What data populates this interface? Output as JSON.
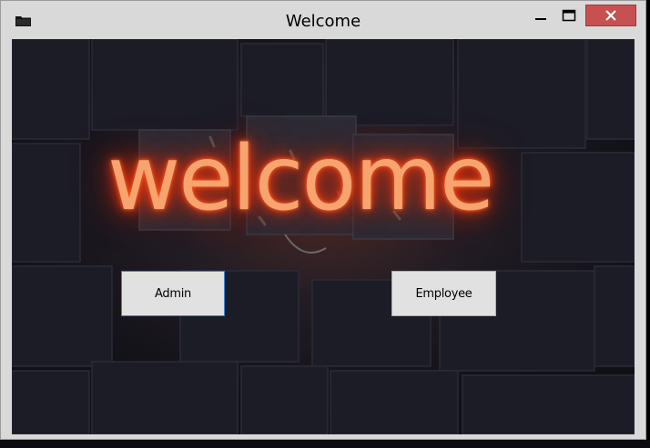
{
  "window": {
    "title": "Welcome",
    "icon": "folder-icon",
    "controls": {
      "minimize": "minimize-icon",
      "maximize": "maximize-icon",
      "close": "close-icon",
      "close_color": "#c75050"
    }
  },
  "banner": {
    "text": "welcome",
    "glow_color": "#ff3b10"
  },
  "buttons": {
    "admin_label": "Admin",
    "employee_label": "Employee"
  }
}
